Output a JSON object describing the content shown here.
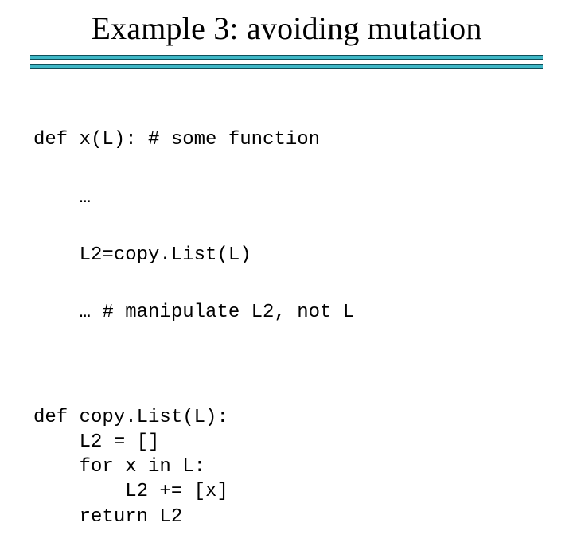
{
  "title": "Example 3: avoiding mutation",
  "code": {
    "l1": "def x(L): # some function",
    "l2": "    …",
    "l3": "    L2=copy.List(L)",
    "l4": "    … # manipulate L2, not L",
    "l5": "def copy.List(L):",
    "l6": "    L2 = []",
    "l7": "    for x in L:",
    "l8": "        L2 += [x]",
    "l9": "    return L2"
  }
}
